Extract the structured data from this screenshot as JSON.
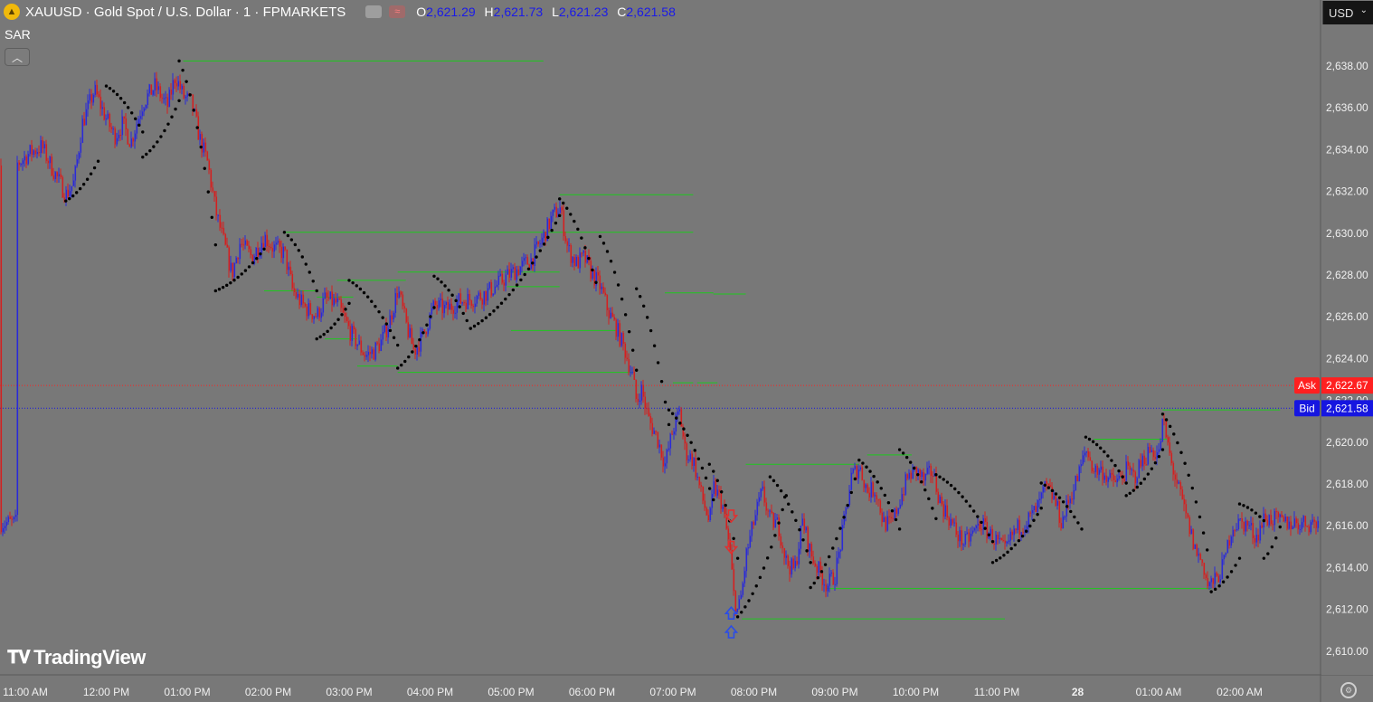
{
  "header": {
    "symbol": "XAUUSD · Gold Spot / U.S. Dollar · 1 · FPMARKETS",
    "ohlc": [
      {
        "k": "O",
        "v": "2,621.29"
      },
      {
        "k": "H",
        "v": "2,621.73"
      },
      {
        "k": "L",
        "v": "2,621.23"
      },
      {
        "k": "C",
        "v": "2,621.58"
      }
    ]
  },
  "indicator_label": "SAR",
  "currency_label": "USD",
  "watermark": "TradingView",
  "colors": {
    "background": "#787878",
    "up": "#2a2ad8",
    "down": "#d42020",
    "sar": "#000000",
    "level": "#1ec81e",
    "ask": "#ff2020",
    "bid": "#1616e0"
  },
  "chart_data": {
    "type": "candlestick",
    "instrument": "XAUUSD",
    "timeframe": "1",
    "y_ticks": [
      2638,
      2636,
      2634,
      2632,
      2630,
      2628,
      2626,
      2624,
      2622,
      2620,
      2618,
      2616,
      2614,
      2612,
      2610
    ],
    "y_tick_labels": [
      "2,638.00",
      "2,636.00",
      "2,634.00",
      "2,632.00",
      "2,630.00",
      "2,628.00",
      "2,626.00",
      "2,624.00",
      "2,622.00",
      "2,620.00",
      "2,618.00",
      "2,616.00",
      "2,614.00",
      "2,612.00",
      "2,610.00"
    ],
    "x_labels": [
      "11:00 AM",
      "12:00 PM",
      "01:00 PM",
      "02:00 PM",
      "03:00 PM",
      "04:00 PM",
      "05:00 PM",
      "06:00 PM",
      "07:00 PM",
      "08:00 PM",
      "09:00 PM",
      "10:00 PM",
      "11:00 PM",
      "28",
      "01:00 AM",
      "02:00 AM"
    ],
    "x_label_hours": [
      0,
      1,
      2,
      3,
      4,
      5,
      6,
      7,
      8,
      9,
      10,
      11,
      12,
      13,
      14,
      15
    ],
    "price_path": [
      [
        -0.12,
        2633.2
      ],
      [
        0.05,
        2633.8
      ],
      [
        0.2,
        2634.1
      ],
      [
        0.35,
        2632.9
      ],
      [
        0.5,
        2631.8
      ],
      [
        0.6,
        2632.4
      ],
      [
        0.7,
        2635.2
      ],
      [
        0.85,
        2636.8
      ],
      [
        1.0,
        2635.4
      ],
      [
        1.1,
        2634.6
      ],
      [
        1.2,
        2635.2
      ],
      [
        1.3,
        2634.3
      ],
      [
        1.45,
        2636.2
      ],
      [
        1.6,
        2637.0
      ],
      [
        1.75,
        2636.0
      ],
      [
        1.85,
        2637.5
      ],
      [
        1.95,
        2636.5
      ],
      [
        2.05,
        2636.2
      ],
      [
        2.15,
        2634.5
      ],
      [
        2.25,
        2633.3
      ],
      [
        2.35,
        2631.0
      ],
      [
        2.45,
        2629.5
      ],
      [
        2.55,
        2628.0
      ],
      [
        2.65,
        2629.5
      ],
      [
        2.8,
        2628.8
      ],
      [
        2.95,
        2629.8
      ],
      [
        3.05,
        2629.3
      ],
      [
        3.2,
        2629.0
      ],
      [
        3.3,
        2627.2
      ],
      [
        3.45,
        2626.4
      ],
      [
        3.6,
        2626.0
      ],
      [
        3.7,
        2626.8
      ],
      [
        3.85,
        2626.6
      ],
      [
        4.0,
        2625.3
      ],
      [
        4.1,
        2624.7
      ],
      [
        4.2,
        2624.1
      ],
      [
        4.3,
        2624.3
      ],
      [
        4.4,
        2624.8
      ],
      [
        4.5,
        2625.8
      ],
      [
        4.6,
        2627.3
      ],
      [
        4.7,
        2625.6
      ],
      [
        4.8,
        2624.3
      ],
      [
        4.9,
        2625.0
      ],
      [
        5.05,
        2626.5
      ],
      [
        5.2,
        2626.3
      ],
      [
        5.35,
        2626.7
      ],
      [
        5.5,
        2626.8
      ],
      [
        5.65,
        2627.0
      ],
      [
        5.8,
        2627.4
      ],
      [
        5.95,
        2627.9
      ],
      [
        6.1,
        2628.3
      ],
      [
        6.25,
        2628.7
      ],
      [
        6.4,
        2629.8
      ],
      [
        6.5,
        2630.7
      ],
      [
        6.6,
        2631.2
      ],
      [
        6.7,
        2629.2
      ],
      [
        6.8,
        2628.5
      ],
      [
        6.9,
        2628.8
      ],
      [
        7.0,
        2628.0
      ],
      [
        7.1,
        2627.4
      ],
      [
        7.2,
        2626.2
      ],
      [
        7.3,
        2625.4
      ],
      [
        7.4,
        2624.4
      ],
      [
        7.5,
        2623.1
      ],
      [
        7.55,
        2621.8
      ],
      [
        7.6,
        2622.6
      ],
      [
        7.7,
        2621.0
      ],
      [
        7.8,
        2620.2
      ],
      [
        7.9,
        2618.9
      ],
      [
        8.0,
        2620.6
      ],
      [
        8.08,
        2621.4
      ],
      [
        8.15,
        2619.5
      ],
      [
        8.25,
        2619.1
      ],
      [
        8.35,
        2617.4
      ],
      [
        8.45,
        2616.1
      ],
      [
        8.5,
        2617.8
      ],
      [
        8.6,
        2617.1
      ],
      [
        8.7,
        2614.8
      ],
      [
        8.75,
        2612.6
      ],
      [
        8.8,
        2611.8
      ],
      [
        8.85,
        2612.8
      ],
      [
        8.9,
        2614.5
      ],
      [
        9.0,
        2616.2
      ],
      [
        9.1,
        2617.6
      ],
      [
        9.2,
        2616.2
      ],
      [
        9.3,
        2616.0
      ],
      [
        9.4,
        2614.2
      ],
      [
        9.5,
        2613.8
      ],
      [
        9.6,
        2616.2
      ],
      [
        9.7,
        2614.6
      ],
      [
        9.8,
        2613.8
      ],
      [
        9.9,
        2613.1
      ],
      [
        10.0,
        2613.6
      ],
      [
        10.1,
        2615.8
      ],
      [
        10.2,
        2618.3
      ],
      [
        10.3,
        2618.8
      ],
      [
        10.4,
        2617.6
      ],
      [
        10.5,
        2617.7
      ],
      [
        10.6,
        2616.1
      ],
      [
        10.7,
        2616.0
      ],
      [
        10.8,
        2617.2
      ],
      [
        10.9,
        2618.3
      ],
      [
        11.0,
        2618.6
      ],
      [
        11.1,
        2618.1
      ],
      [
        11.2,
        2618.6
      ],
      [
        11.3,
        2617.1
      ],
      [
        11.4,
        2616.4
      ],
      [
        11.5,
        2615.6
      ],
      [
        11.6,
        2615.1
      ],
      [
        11.7,
        2615.6
      ],
      [
        11.8,
        2616.1
      ],
      [
        11.9,
        2615.6
      ],
      [
        12.0,
        2615.2
      ],
      [
        12.1,
        2614.7
      ],
      [
        12.2,
        2615.6
      ],
      [
        12.3,
        2616.0
      ],
      [
        12.4,
        2616.3
      ],
      [
        12.5,
        2616.8
      ],
      [
        12.6,
        2617.8
      ],
      [
        12.7,
        2617.3
      ],
      [
        12.8,
        2616.1
      ],
      [
        12.9,
        2617.3
      ],
      [
        13.0,
        2618.3
      ],
      [
        13.1,
        2619.6
      ],
      [
        13.2,
        2618.6
      ],
      [
        13.3,
        2618.6
      ],
      [
        13.4,
        2618.1
      ],
      [
        13.5,
        2618.1
      ],
      [
        13.6,
        2618.6
      ],
      [
        13.7,
        2618.3
      ],
      [
        13.8,
        2619.1
      ],
      [
        13.9,
        2619.6
      ],
      [
        14.0,
        2619.4
      ],
      [
        14.05,
        2621.0
      ],
      [
        14.15,
        2619.0
      ],
      [
        14.25,
        2617.6
      ],
      [
        14.35,
        2616.2
      ],
      [
        14.45,
        2614.8
      ],
      [
        14.55,
        2614.1
      ],
      [
        14.6,
        2613.1
      ],
      [
        14.7,
        2613.3
      ],
      [
        14.8,
        2614.1
      ],
      [
        14.9,
        2615.9
      ],
      [
        15.0,
        2616.1
      ],
      [
        15.1,
        2616.0
      ],
      [
        15.2,
        2615.4
      ],
      [
        15.3,
        2616.3
      ],
      [
        15.4,
        2616.3
      ],
      [
        15.5,
        2616.1
      ]
    ],
    "sar_segments": [
      {
        "h0": 0.5,
        "h1": 0.9,
        "v0": 2631.5,
        "v1": 2633.4
      },
      {
        "h0": 1.0,
        "h1": 1.45,
        "v0": 2637.0,
        "v1": 2634.8
      },
      {
        "h0": 1.45,
        "h1": 1.9,
        "v0": 2633.6,
        "v1": 2636.3
      },
      {
        "h0": 1.9,
        "h1": 2.35,
        "v0": 2638.2,
        "v1": 2629.4
      },
      {
        "h0": 2.35,
        "h1": 2.95,
        "v0": 2627.2,
        "v1": 2629.2
      },
      {
        "h0": 3.2,
        "h1": 3.6,
        "v0": 2630.0,
        "v1": 2627.2
      },
      {
        "h0": 3.6,
        "h1": 4.0,
        "v0": 2624.9,
        "v1": 2626.6
      },
      {
        "h0": 4.0,
        "h1": 4.6,
        "v0": 2627.7,
        "v1": 2624.6
      },
      {
        "h0": 4.6,
        "h1": 5.05,
        "v0": 2623.5,
        "v1": 2626.4
      },
      {
        "h0": 5.05,
        "h1": 5.5,
        "v0": 2627.9,
        "v1": 2625.4
      },
      {
        "h0": 5.5,
        "h1": 6.6,
        "v0": 2625.4,
        "v1": 2630.8
      },
      {
        "h0": 6.6,
        "h1": 7.05,
        "v0": 2631.6,
        "v1": 2627.6
      },
      {
        "h0": 7.1,
        "h1": 7.55,
        "v0": 2629.8,
        "v1": 2623.4
      },
      {
        "h0": 7.55,
        "h1": 7.95,
        "v0": 2627.3,
        "v1": 2620.8
      },
      {
        "h0": 7.95,
        "h1": 8.5,
        "v0": 2621.5,
        "v1": 2617.2
      },
      {
        "h0": 8.45,
        "h1": 8.8,
        "v0": 2618.9,
        "v1": 2614.4
      },
      {
        "h0": 8.8,
        "h1": 9.4,
        "v0": 2611.6,
        "v1": 2617.4
      },
      {
        "h0": 9.2,
        "h1": 9.7,
        "v0": 2618.3,
        "v1": 2614.2
      },
      {
        "h0": 9.7,
        "h1": 10.25,
        "v0": 2613.0,
        "v1": 2618.2
      },
      {
        "h0": 10.3,
        "h1": 10.8,
        "v0": 2619.1,
        "v1": 2615.8
      },
      {
        "h0": 10.8,
        "h1": 11.25,
        "v0": 2619.6,
        "v1": 2616.3
      },
      {
        "h0": 11.25,
        "h1": 11.95,
        "v0": 2618.4,
        "v1": 2615.2
      },
      {
        "h0": 11.95,
        "h1": 12.55,
        "v0": 2614.2,
        "v1": 2616.8
      },
      {
        "h0": 12.55,
        "h1": 13.05,
        "v0": 2618.0,
        "v1": 2615.8
      },
      {
        "h0": 13.1,
        "h1": 13.6,
        "v0": 2620.2,
        "v1": 2618.0
      },
      {
        "h0": 13.6,
        "h1": 14.05,
        "v0": 2617.4,
        "v1": 2619.6
      },
      {
        "h0": 14.05,
        "h1": 14.6,
        "v0": 2621.3,
        "v1": 2614.8
      },
      {
        "h0": 14.65,
        "h1": 15.0,
        "v0": 2612.8,
        "v1": 2614.4
      },
      {
        "h0": 15.0,
        "h1": 15.3,
        "v0": 2617.0,
        "v1": 2616.2
      },
      {
        "h0": 15.3,
        "h1": 15.5,
        "v0": 2614.4,
        "v1": 2615.9
      }
    ],
    "levels": [
      {
        "price": 2638.2,
        "h0": 1.95,
        "h1": 6.4
      },
      {
        "price": 2631.8,
        "h0": 6.6,
        "h1": 8.25
      },
      {
        "price": 2630.0,
        "h0": 3.2,
        "h1": 8.25
      },
      {
        "price": 2628.1,
        "h0": 4.6,
        "h1": 6.6
      },
      {
        "price": 2627.7,
        "h0": 3.85,
        "h1": 4.7
      },
      {
        "price": 2627.4,
        "h0": 5.95,
        "h1": 6.6
      },
      {
        "price": 2627.2,
        "h0": 2.95,
        "h1": 3.6
      },
      {
        "price": 2626.9,
        "h0": 3.6,
        "h1": 4.05
      },
      {
        "price": 2627.1,
        "h0": 7.9,
        "h1": 8.5
      },
      {
        "price": 2627.05,
        "h0": 8.5,
        "h1": 8.9
      },
      {
        "price": 2625.3,
        "h0": 6.0,
        "h1": 7.3
      },
      {
        "price": 2624.9,
        "h0": 3.7,
        "h1": 4.1
      },
      {
        "price": 2623.6,
        "h0": 4.1,
        "h1": 4.6
      },
      {
        "price": 2623.3,
        "h0": 4.6,
        "h1": 7.5
      },
      {
        "price": 2622.8,
        "h0": 8.3,
        "h1": 8.55
      },
      {
        "price": 2622.8,
        "h0": 8.0,
        "h1": 8.25
      },
      {
        "price": 2621.5,
        "h0": 14.05,
        "h1": 15.5
      },
      {
        "price": 2620.1,
        "h0": 13.2,
        "h1": 14.1
      },
      {
        "price": 2619.35,
        "h0": 10.4,
        "h1": 10.95
      },
      {
        "price": 2618.9,
        "h0": 8.9,
        "h1": 10.3
      },
      {
        "price": 2612.95,
        "h0": 9.9,
        "h1": 14.65
      },
      {
        "price": 2611.5,
        "h0": 8.85,
        "h1": 12.1
      }
    ],
    "ask": {
      "label": "Ask",
      "value": 2622.67,
      "text": "2,622.67"
    },
    "bid": {
      "label": "Bid",
      "value": 2621.58,
      "text": "2,621.58"
    },
    "partial_tick": "2,622.00",
    "signals": [
      {
        "type": "down",
        "hour": 8.72,
        "price": 2616.4
      },
      {
        "type": "down",
        "hour": 8.72,
        "price": 2614.9
      },
      {
        "type": "up",
        "hour": 8.72,
        "price": 2611.8
      },
      {
        "type": "up",
        "hour": 8.72,
        "price": 2610.9
      }
    ]
  }
}
